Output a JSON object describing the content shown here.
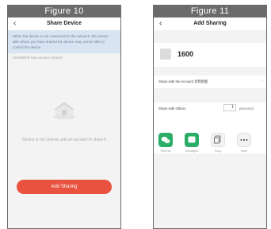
{
  "left": {
    "figure_label": "Figure 10",
    "nav": {
      "back_icon": "‹",
      "title": "Share Device"
    },
    "notice": "When the device is not connected to the network, the person with whom you have shared the device may not be able to control the device.",
    "status_line": "SGWSBPR has not been shared",
    "empty_text": "Device is not shared, add an account to share it",
    "add_button": "Add Sharing"
  },
  "right": {
    "figure_label": "Figure 11",
    "nav": {
      "back_icon": "‹",
      "title": "Add Sharing"
    },
    "device_name": "1600",
    "share_account_label": "Share with the Account 涂鸦智能",
    "chevron": "›",
    "share_others_label": "Share with Others",
    "person_count": "1",
    "person_unit": "person(s)",
    "options": [
      {
        "label": "WeChat",
        "icon": "wechat-icon",
        "color": "#2aae67"
      },
      {
        "label": "Messages",
        "icon": "messages-icon",
        "color": "#2aae67"
      },
      {
        "label": "Copy",
        "icon": "copy-icon",
        "color": "#f3f3f3"
      },
      {
        "label": "More",
        "icon": "more-icon",
        "color": "#f3f3f3"
      }
    ]
  },
  "colors": {
    "accent": "#e8523f",
    "notice_bg": "#d8e4f1",
    "figure_bar": "#6b6b6b"
  }
}
